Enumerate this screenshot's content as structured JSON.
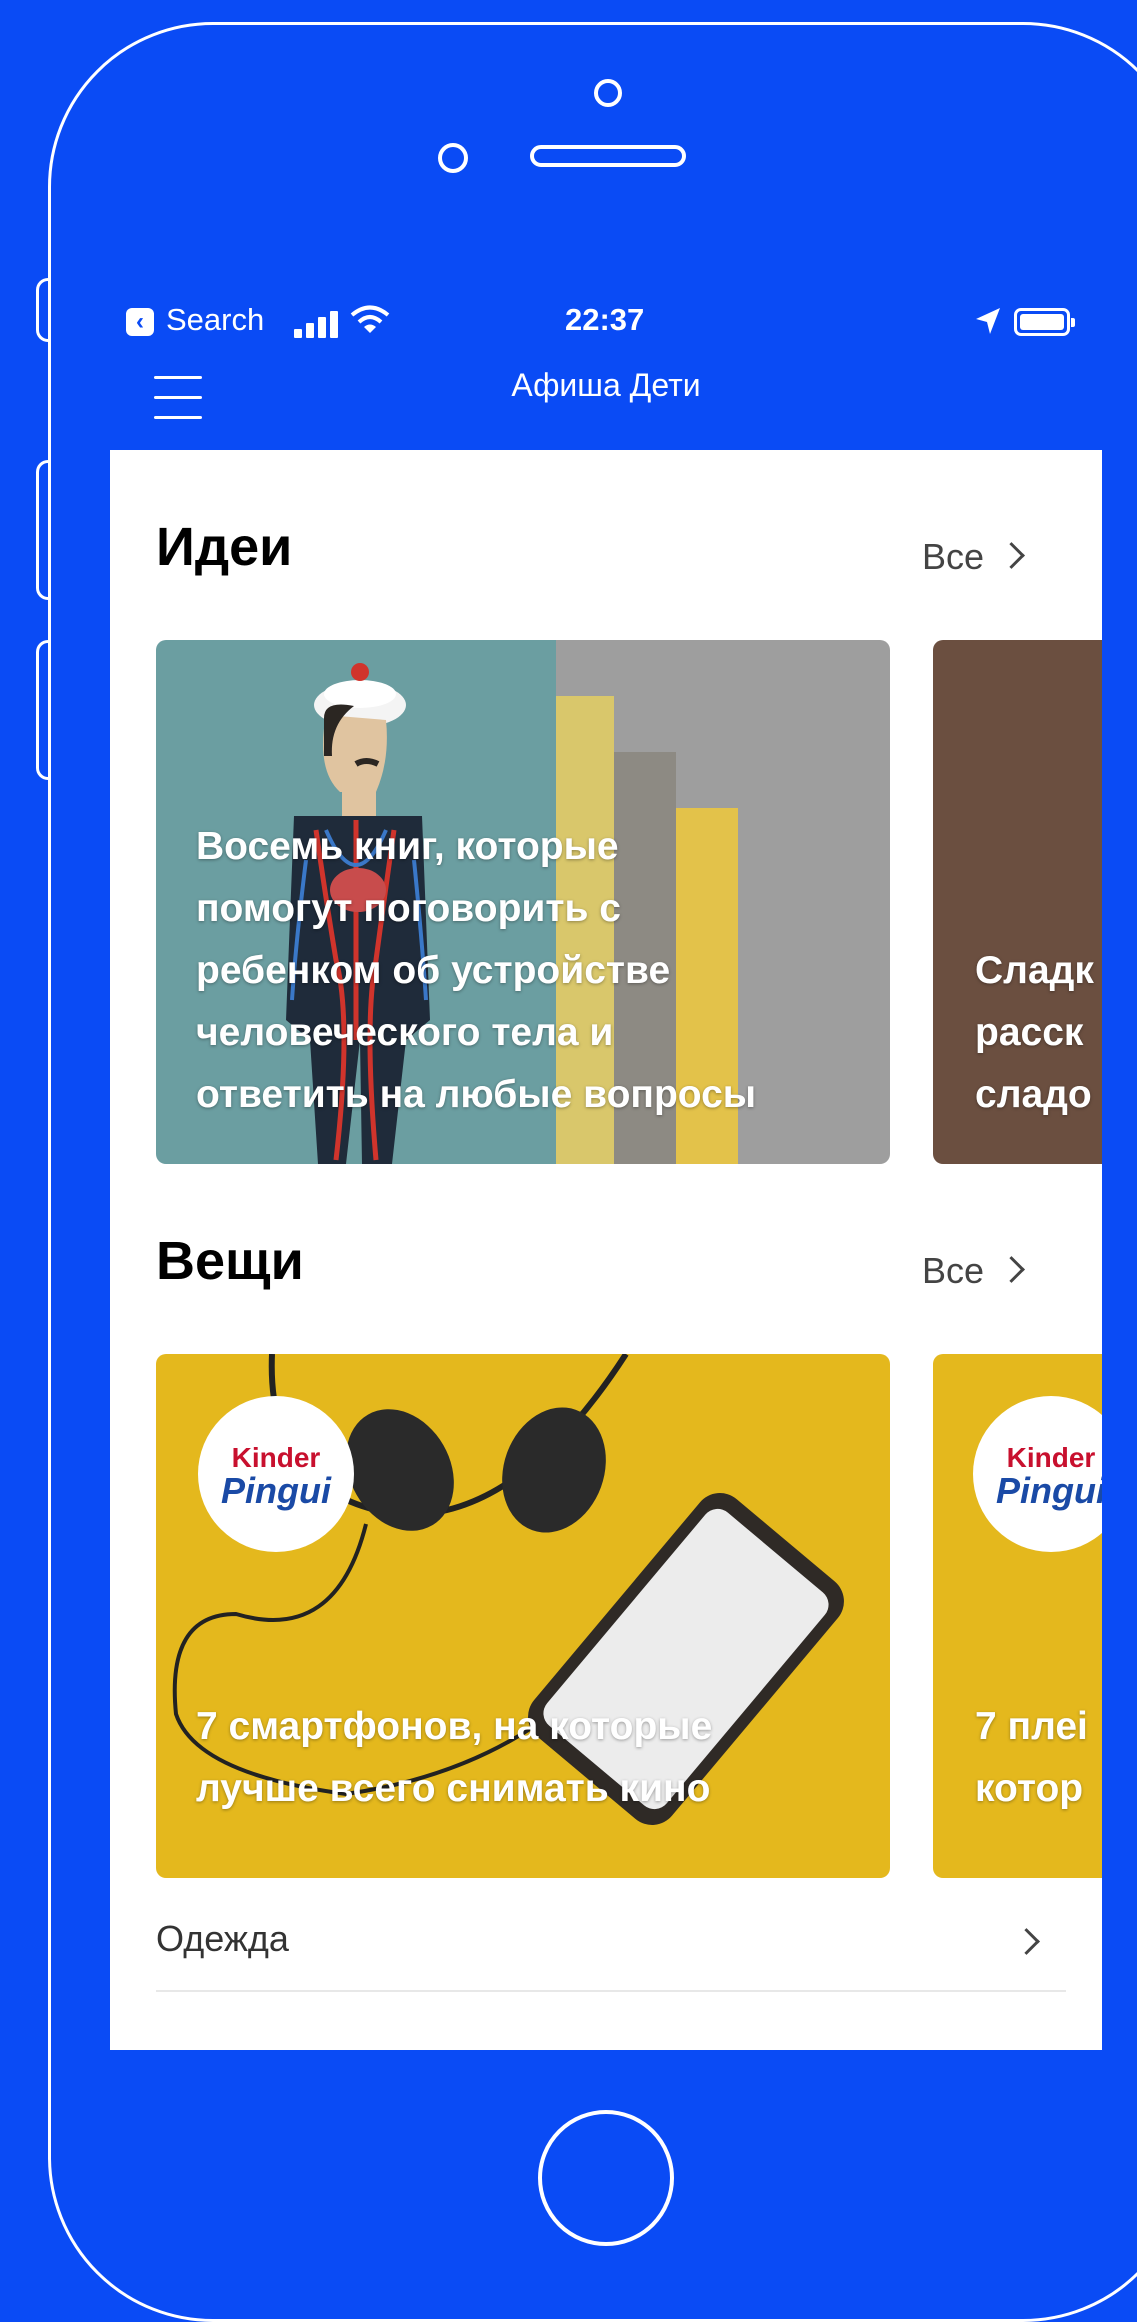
{
  "status_bar": {
    "back_app": "Search",
    "time": "22:37"
  },
  "nav": {
    "title": "Афиша Дети"
  },
  "sections": {
    "ideas": {
      "title": "Идеи",
      "see_all": "Все",
      "cards": [
        {
          "text": "Восемь книг, которые\nпомогут поговорить с\nребенком об устройстве\nчеловеческого тела и\nответить на любые вопросы"
        },
        {
          "text": "Сладк\nрасск\nсладо"
        }
      ]
    },
    "things": {
      "title": "Вещи",
      "see_all": "Все",
      "cards": [
        {
          "brand_top": "Kinder",
          "brand_bottom": "Pingui",
          "text": "7 смартфонов, на которые\nлучше всего снимать кино"
        },
        {
          "brand_top": "Kinder",
          "brand_bottom": "Pingui",
          "text": "7 плеі\nкотор"
        }
      ]
    }
  },
  "list": {
    "items": [
      {
        "label": "Одежда"
      }
    ]
  },
  "colors": {
    "brand_blue": "#0a4bf5",
    "card_yellow": "#e4b81d",
    "card_brown": "#6b4f40"
  }
}
